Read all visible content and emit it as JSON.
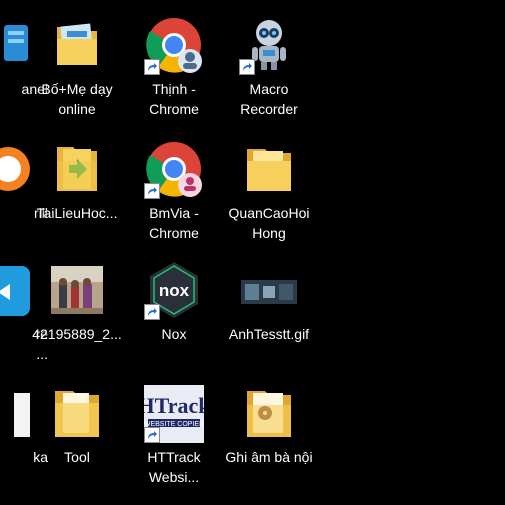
{
  "desktop": {
    "icons": [
      {
        "label": "Control Panel",
        "visible_label": "anel",
        "icon": "control-panel-icon"
      },
      {
        "label": "Bố+Mẹ dạy online",
        "icon": "folder-icon"
      },
      {
        "label": "Thịnh - Chrome",
        "icon": "chrome-icon"
      },
      {
        "label": "Macro Recorder",
        "icon": "robot-icon"
      },
      {
        "label": "rill",
        "icon": "app-icon"
      },
      {
        "label": "TaiLieuHoc...",
        "icon": "folder-icon"
      },
      {
        "label": "BmVia - Chrome",
        "icon": "chrome-icon"
      },
      {
        "label": "QuanCaoHoi Hong",
        "icon": "folder-icon"
      },
      {
        "label": "re\n...",
        "icon": "app-icon"
      },
      {
        "label": "42195889_2...",
        "icon": "photo-icon"
      },
      {
        "label": "Nox",
        "icon": "nox-icon"
      },
      {
        "label": "AnhTesstt.gif",
        "icon": "image-file-icon"
      },
      {
        "label": "ka",
        "icon": "file-icon"
      },
      {
        "label": "Tool",
        "icon": "folder-icon"
      },
      {
        "label": "HTTrack Websi...",
        "icon": "httrack-icon"
      },
      {
        "label": "Ghi âm bà nội",
        "icon": "folder-icon"
      }
    ]
  },
  "colors": {
    "background": "#000000",
    "folder": "#f2c94c",
    "chrome_red": "#db4437",
    "chrome_green": "#0f9d58",
    "chrome_yellow": "#f4b400",
    "chrome_blue": "#4285f4",
    "nox": "#2b2f3a"
  }
}
